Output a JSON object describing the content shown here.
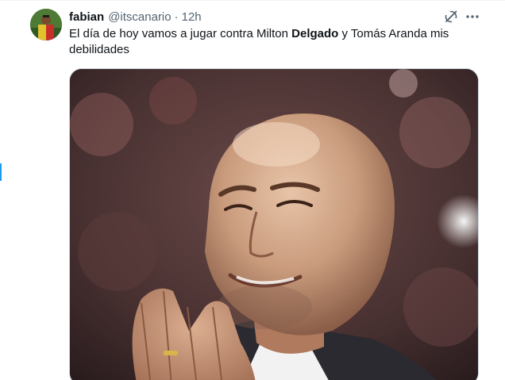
{
  "tweet": {
    "author": {
      "display_name": "fabian",
      "handle": "@itscanario",
      "separator": "·",
      "time": "12h"
    },
    "text": {
      "part1": "El día de hoy vamos a jugar contra Milton ",
      "bold": "Delgado",
      "part2": " y Tomás Aranda mis debilidades"
    },
    "actions": {
      "grok_icon": "grok-icon",
      "more_icon": "more-horizontal-icon"
    },
    "media": {
      "type": "image"
    }
  },
  "colors": {
    "text_primary": "#0f1419",
    "text_secondary": "#536471",
    "accent": "#1d9bf0",
    "border": "#cfd9de"
  }
}
